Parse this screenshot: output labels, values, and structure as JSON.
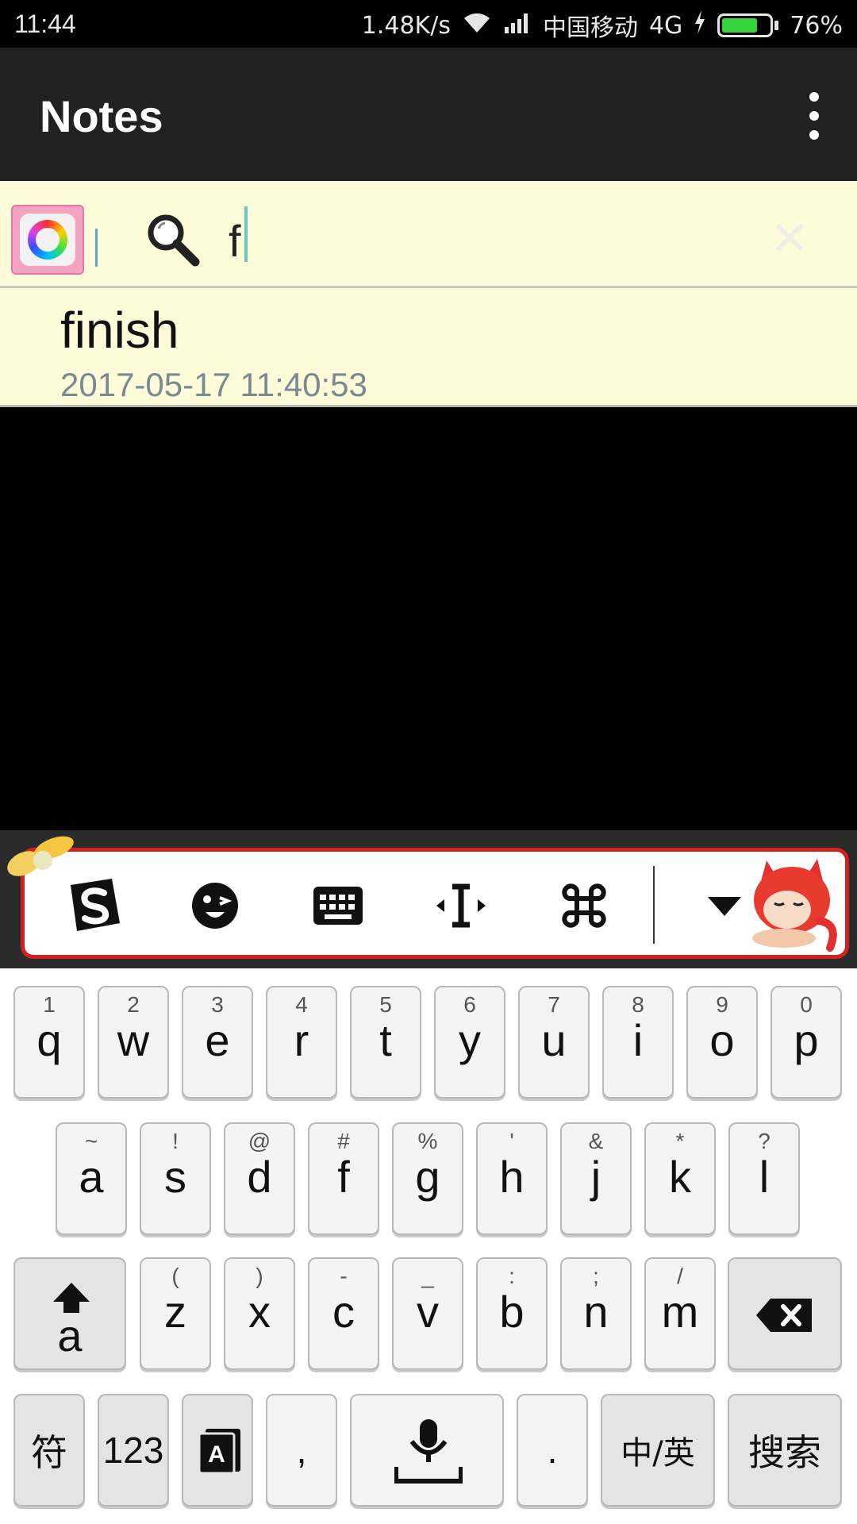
{
  "status_bar": {
    "time": "11:44",
    "net_speed": "1.48K/s",
    "carrier": "中国移动",
    "network": "4G",
    "battery": "76%",
    "battery_level": 0.76,
    "icons": [
      "wifi-icon",
      "signal-icon",
      "charging-icon",
      "battery-icon"
    ]
  },
  "app_bar": {
    "title": "Notes",
    "menu_icon": "overflow-menu-icon"
  },
  "search": {
    "color_button_icon": "color-palette-icon",
    "search_icon": "magnifier-icon",
    "value": "f",
    "clear_icon": "clear-icon",
    "clear_label": "✕"
  },
  "results": [
    {
      "title": "finish",
      "date": "2017-05-17 11:40:53"
    }
  ],
  "ime_toolbar": {
    "icons": [
      "sogou-logo-icon",
      "emoji-icon",
      "keyboard-icon",
      "cursor-move-icon",
      "command-icon",
      "hide-keyboard-icon"
    ]
  },
  "keyboard": {
    "row1": [
      {
        "sub": "1",
        "key": "q"
      },
      {
        "sub": "2",
        "key": "w"
      },
      {
        "sub": "3",
        "key": "e"
      },
      {
        "sub": "4",
        "key": "r"
      },
      {
        "sub": "5",
        "key": "t"
      },
      {
        "sub": "6",
        "key": "y"
      },
      {
        "sub": "7",
        "key": "u"
      },
      {
        "sub": "8",
        "key": "i"
      },
      {
        "sub": "9",
        "key": "o"
      },
      {
        "sub": "0",
        "key": "p"
      }
    ],
    "row2": [
      {
        "sub": "~",
        "key": "a"
      },
      {
        "sub": "!",
        "key": "s"
      },
      {
        "sub": "@",
        "key": "d"
      },
      {
        "sub": "#",
        "key": "f"
      },
      {
        "sub": "%",
        "key": "g"
      },
      {
        "sub": "'",
        "key": "h"
      },
      {
        "sub": "&",
        "key": "j"
      },
      {
        "sub": "*",
        "key": "k"
      },
      {
        "sub": "?",
        "key": "l"
      }
    ],
    "row3": [
      {
        "sub": "(",
        "key": "z"
      },
      {
        "sub": ")",
        "key": "x"
      },
      {
        "sub": "-",
        "key": "c"
      },
      {
        "sub": "_",
        "key": "v"
      },
      {
        "sub": ":",
        "key": "b"
      },
      {
        "sub": ";",
        "key": "n"
      },
      {
        "sub": "/",
        "key": "m"
      }
    ],
    "shift_label": "a",
    "symbols_label": "符",
    "numbers_label": "123",
    "comma_label": ",",
    "period_label": ".",
    "lang_label": "中/英",
    "search_label": "搜索"
  }
}
